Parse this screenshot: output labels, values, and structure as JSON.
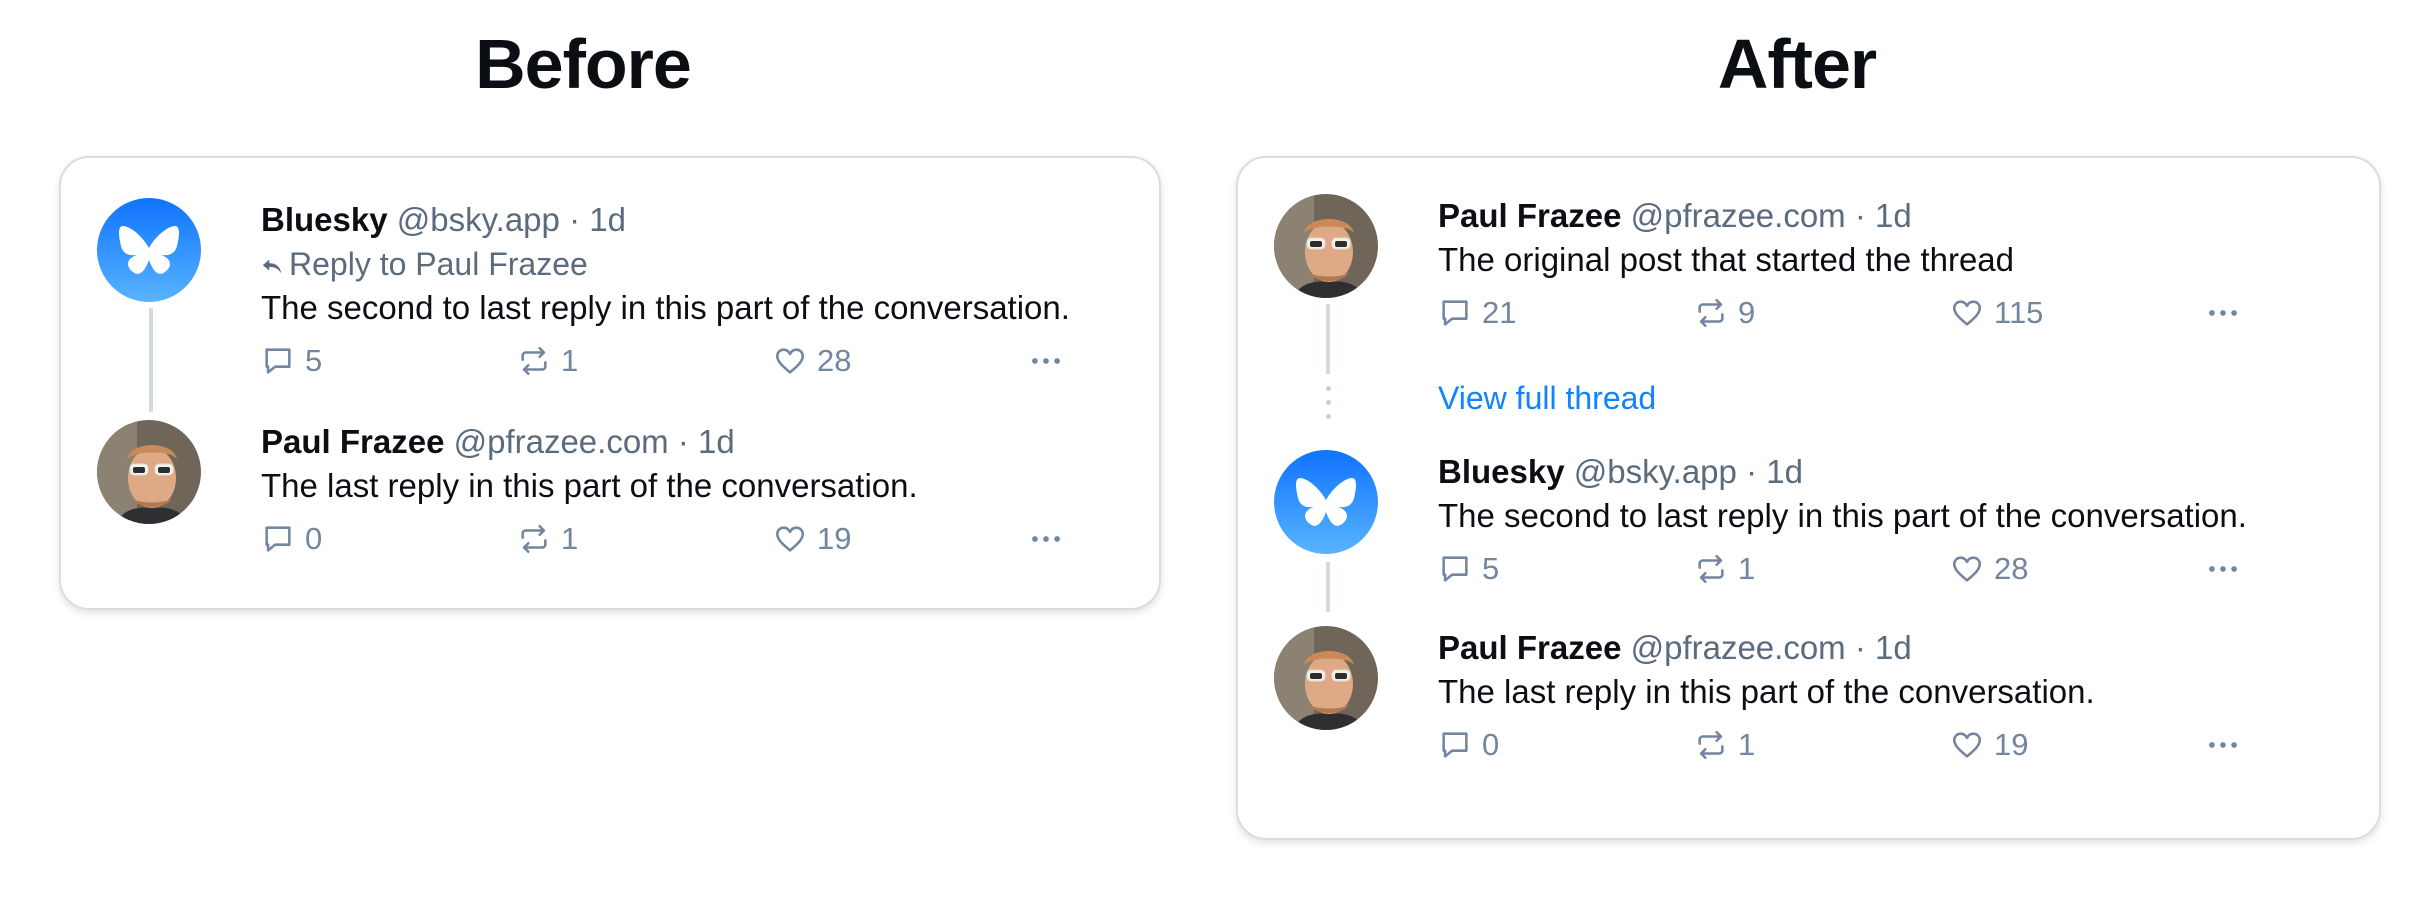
{
  "titles": {
    "before": "Before",
    "after": "After"
  },
  "before": {
    "posts": [
      {
        "author": "Bluesky",
        "handle": "@bsky.app",
        "dot": "·",
        "time": "1d",
        "reply_to": "Reply to Paul Frazee",
        "text": "The second to last reply in this part of the conversation.",
        "replies": "5",
        "reposts": "1",
        "likes": "28"
      },
      {
        "author": "Paul Frazee",
        "handle": "@pfrazee.com",
        "dot": "·",
        "time": "1d",
        "text": "The last reply in this part of the conversation.",
        "replies": "0",
        "reposts": "1",
        "likes": "19"
      }
    ]
  },
  "after": {
    "posts": [
      {
        "author": "Paul Frazee",
        "handle": "@pfrazee.com",
        "dot": "·",
        "time": "1d",
        "text": "The original post that started the thread",
        "replies": "21",
        "reposts": "9",
        "likes": "115"
      },
      {
        "author": "Bluesky",
        "handle": "@bsky.app",
        "dot": "·",
        "time": "1d",
        "text": "The second to last reply in this part of the conversation.",
        "replies": "5",
        "reposts": "1",
        "likes": "28"
      },
      {
        "author": "Paul Frazee",
        "handle": "@pfrazee.com",
        "dot": "·",
        "time": "1d",
        "text": "The last reply in this part of the conversation.",
        "replies": "0",
        "reposts": "1",
        "likes": "19"
      }
    ],
    "view_full_thread": "View full thread"
  },
  "colors": {
    "accent": "#1083fe",
    "muted": "#5b6b7e",
    "icon": "#7386a0",
    "bluesky_gradient": [
      "#0f73ff",
      "#58b4ff"
    ]
  },
  "icons": [
    "butterfly-logo",
    "reply-arrow-icon",
    "comment-icon",
    "repost-icon",
    "heart-icon",
    "more-dots-icon"
  ]
}
